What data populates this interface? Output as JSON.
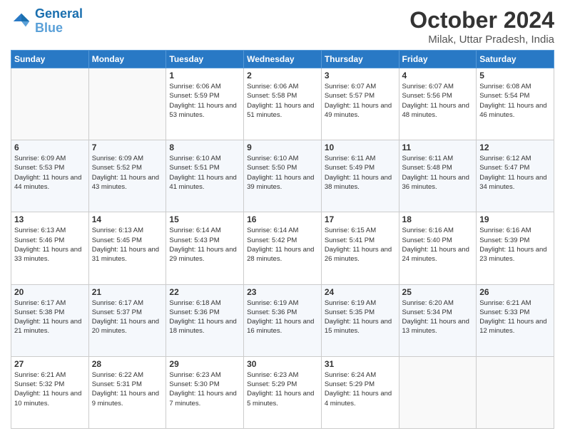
{
  "header": {
    "logo_line1": "General",
    "logo_line2": "Blue",
    "month": "October 2024",
    "location": "Milak, Uttar Pradesh, India"
  },
  "weekdays": [
    "Sunday",
    "Monday",
    "Tuesday",
    "Wednesday",
    "Thursday",
    "Friday",
    "Saturday"
  ],
  "weeks": [
    [
      {
        "day": "",
        "info": ""
      },
      {
        "day": "",
        "info": ""
      },
      {
        "day": "1",
        "info": "Sunrise: 6:06 AM\nSunset: 5:59 PM\nDaylight: 11 hours and 53 minutes."
      },
      {
        "day": "2",
        "info": "Sunrise: 6:06 AM\nSunset: 5:58 PM\nDaylight: 11 hours and 51 minutes."
      },
      {
        "day": "3",
        "info": "Sunrise: 6:07 AM\nSunset: 5:57 PM\nDaylight: 11 hours and 49 minutes."
      },
      {
        "day": "4",
        "info": "Sunrise: 6:07 AM\nSunset: 5:56 PM\nDaylight: 11 hours and 48 minutes."
      },
      {
        "day": "5",
        "info": "Sunrise: 6:08 AM\nSunset: 5:54 PM\nDaylight: 11 hours and 46 minutes."
      }
    ],
    [
      {
        "day": "6",
        "info": "Sunrise: 6:09 AM\nSunset: 5:53 PM\nDaylight: 11 hours and 44 minutes."
      },
      {
        "day": "7",
        "info": "Sunrise: 6:09 AM\nSunset: 5:52 PM\nDaylight: 11 hours and 43 minutes."
      },
      {
        "day": "8",
        "info": "Sunrise: 6:10 AM\nSunset: 5:51 PM\nDaylight: 11 hours and 41 minutes."
      },
      {
        "day": "9",
        "info": "Sunrise: 6:10 AM\nSunset: 5:50 PM\nDaylight: 11 hours and 39 minutes."
      },
      {
        "day": "10",
        "info": "Sunrise: 6:11 AM\nSunset: 5:49 PM\nDaylight: 11 hours and 38 minutes."
      },
      {
        "day": "11",
        "info": "Sunrise: 6:11 AM\nSunset: 5:48 PM\nDaylight: 11 hours and 36 minutes."
      },
      {
        "day": "12",
        "info": "Sunrise: 6:12 AM\nSunset: 5:47 PM\nDaylight: 11 hours and 34 minutes."
      }
    ],
    [
      {
        "day": "13",
        "info": "Sunrise: 6:13 AM\nSunset: 5:46 PM\nDaylight: 11 hours and 33 minutes."
      },
      {
        "day": "14",
        "info": "Sunrise: 6:13 AM\nSunset: 5:45 PM\nDaylight: 11 hours and 31 minutes."
      },
      {
        "day": "15",
        "info": "Sunrise: 6:14 AM\nSunset: 5:43 PM\nDaylight: 11 hours and 29 minutes."
      },
      {
        "day": "16",
        "info": "Sunrise: 6:14 AM\nSunset: 5:42 PM\nDaylight: 11 hours and 28 minutes."
      },
      {
        "day": "17",
        "info": "Sunrise: 6:15 AM\nSunset: 5:41 PM\nDaylight: 11 hours and 26 minutes."
      },
      {
        "day": "18",
        "info": "Sunrise: 6:16 AM\nSunset: 5:40 PM\nDaylight: 11 hours and 24 minutes."
      },
      {
        "day": "19",
        "info": "Sunrise: 6:16 AM\nSunset: 5:39 PM\nDaylight: 11 hours and 23 minutes."
      }
    ],
    [
      {
        "day": "20",
        "info": "Sunrise: 6:17 AM\nSunset: 5:38 PM\nDaylight: 11 hours and 21 minutes."
      },
      {
        "day": "21",
        "info": "Sunrise: 6:17 AM\nSunset: 5:37 PM\nDaylight: 11 hours and 20 minutes."
      },
      {
        "day": "22",
        "info": "Sunrise: 6:18 AM\nSunset: 5:36 PM\nDaylight: 11 hours and 18 minutes."
      },
      {
        "day": "23",
        "info": "Sunrise: 6:19 AM\nSunset: 5:36 PM\nDaylight: 11 hours and 16 minutes."
      },
      {
        "day": "24",
        "info": "Sunrise: 6:19 AM\nSunset: 5:35 PM\nDaylight: 11 hours and 15 minutes."
      },
      {
        "day": "25",
        "info": "Sunrise: 6:20 AM\nSunset: 5:34 PM\nDaylight: 11 hours and 13 minutes."
      },
      {
        "day": "26",
        "info": "Sunrise: 6:21 AM\nSunset: 5:33 PM\nDaylight: 11 hours and 12 minutes."
      }
    ],
    [
      {
        "day": "27",
        "info": "Sunrise: 6:21 AM\nSunset: 5:32 PM\nDaylight: 11 hours and 10 minutes."
      },
      {
        "day": "28",
        "info": "Sunrise: 6:22 AM\nSunset: 5:31 PM\nDaylight: 11 hours and 9 minutes."
      },
      {
        "day": "29",
        "info": "Sunrise: 6:23 AM\nSunset: 5:30 PM\nDaylight: 11 hours and 7 minutes."
      },
      {
        "day": "30",
        "info": "Sunrise: 6:23 AM\nSunset: 5:29 PM\nDaylight: 11 hours and 5 minutes."
      },
      {
        "day": "31",
        "info": "Sunrise: 6:24 AM\nSunset: 5:29 PM\nDaylight: 11 hours and 4 minutes."
      },
      {
        "day": "",
        "info": ""
      },
      {
        "day": "",
        "info": ""
      }
    ]
  ]
}
